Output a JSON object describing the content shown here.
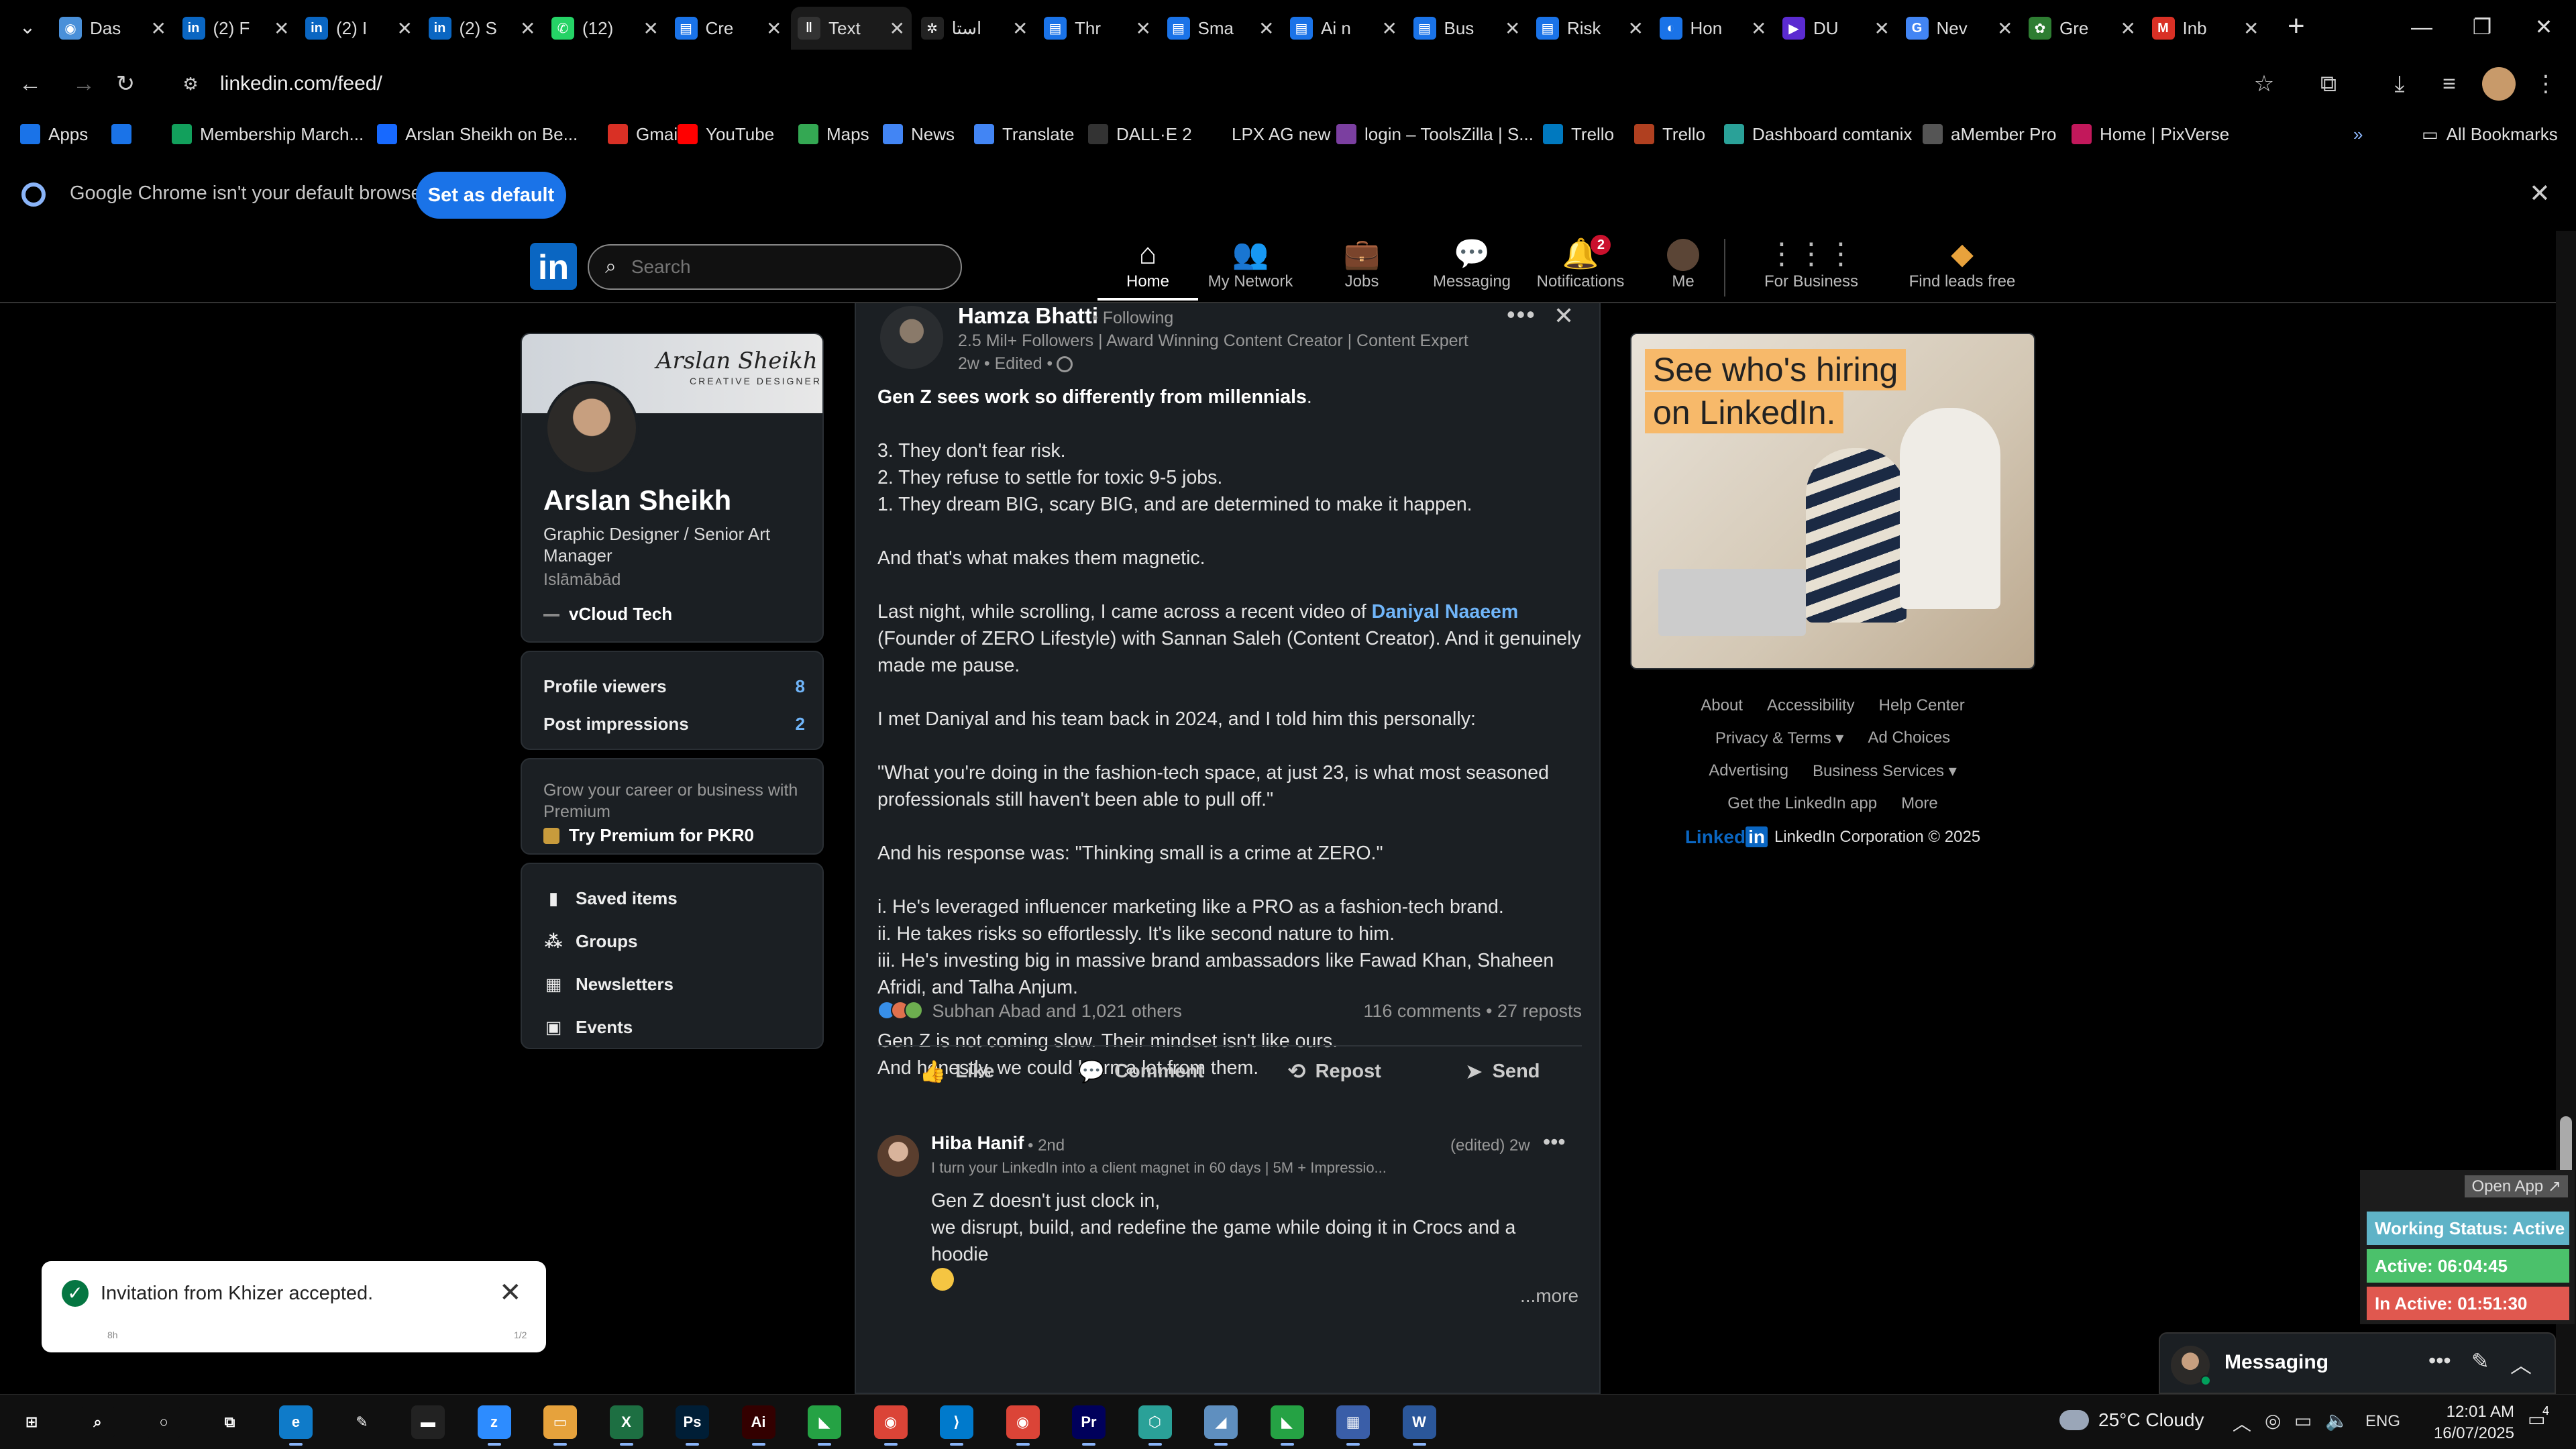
{
  "browser": {
    "tabs": [
      {
        "title": "Das",
        "icon": "chrome-icon",
        "color": "#4a90d9",
        "glyph": "◉"
      },
      {
        "title": "(2) F",
        "icon": "linkedin-icon",
        "color": "#0a66c2",
        "glyph": "in"
      },
      {
        "title": "(2) I",
        "icon": "linkedin-icon",
        "color": "#0a66c2",
        "glyph": "in"
      },
      {
        "title": "(2) S",
        "icon": "linkedin-icon",
        "color": "#0a66c2",
        "glyph": "in"
      },
      {
        "title": "(12)",
        "icon": "whatsapp-icon",
        "color": "#25d366",
        "glyph": "✆"
      },
      {
        "title": "Cre",
        "icon": "docs-icon",
        "color": "#1a73e8",
        "glyph": "▤"
      },
      {
        "title": "Text",
        "icon": "pause-icon",
        "color": "#333333",
        "glyph": "‖"
      },
      {
        "title": "استا",
        "icon": "openai-icon",
        "color": "#222222",
        "glyph": "✲"
      },
      {
        "title": "Thr",
        "icon": "docs-icon",
        "color": "#1a73e8",
        "glyph": "▤"
      },
      {
        "title": "Sma",
        "icon": "docs-icon",
        "color": "#1a73e8",
        "glyph": "▤"
      },
      {
        "title": "Ai n",
        "icon": "docs-icon",
        "color": "#1a73e8",
        "glyph": "▤"
      },
      {
        "title": "Bus",
        "icon": "docs-icon",
        "color": "#1a73e8",
        "glyph": "▤"
      },
      {
        "title": "Risk",
        "icon": "docs-icon",
        "color": "#1a73e8",
        "glyph": "▤"
      },
      {
        "title": "Hon",
        "icon": "globe-icon",
        "color": "#1a73e8",
        "glyph": "◐"
      },
      {
        "title": "DU",
        "icon": "video-icon",
        "color": "#5b2bd1",
        "glyph": "▶"
      },
      {
        "title": "Nev",
        "icon": "google-icon",
        "color": "#4285f4",
        "glyph": "G"
      },
      {
        "title": "Gre",
        "icon": "palm-icon",
        "color": "#2e7d32",
        "glyph": "✿"
      },
      {
        "title": "Inb",
        "icon": "gmail-icon",
        "color": "#d93025",
        "glyph": "M"
      }
    ],
    "new_tab": "+",
    "url": "linkedin.com/feed/",
    "bookmarks": [
      {
        "label": "Apps",
        "icon": "apps-grid-icon",
        "color": "#1a73e8"
      },
      {
        "label": "",
        "icon": "grid-icon",
        "color": "#1a73e8"
      },
      {
        "label": "Membership March...",
        "icon": "bookmark-green-icon",
        "color": "#12a05c"
      },
      {
        "label": "Arslan Sheikh on Be...",
        "icon": "behance-icon",
        "color": "#1769ff"
      },
      {
        "label": "Gmail",
        "icon": "gmail-icon",
        "color": "#d93025"
      },
      {
        "label": "YouTube",
        "icon": "youtube-icon",
        "color": "#ff0000"
      },
      {
        "label": "Maps",
        "icon": "maps-icon",
        "color": "#34a853"
      },
      {
        "label": "News",
        "icon": "news-icon",
        "color": "#4285f4"
      },
      {
        "label": "Translate",
        "icon": "translate-icon",
        "color": "#4285f4"
      },
      {
        "label": "DALL·E 2",
        "icon": "openai-icon",
        "color": "#333333"
      },
      {
        "label": "LPX AG new",
        "icon": "dash-icon",
        "color": "#000000"
      },
      {
        "label": "login – ToolsZilla | S...",
        "icon": "toolszilla-icon",
        "color": "#7b3fa0"
      },
      {
        "label": "Trello",
        "icon": "trello-icon",
        "color": "#0079bf"
      },
      {
        "label": "Trello",
        "icon": "trello-icon",
        "color": "#b04020"
      },
      {
        "label": "Dashboard comtanix",
        "icon": "dashboard-icon",
        "color": "#2aa198"
      },
      {
        "label": "aMember Pro",
        "icon": "amember-icon",
        "color": "#555555"
      },
      {
        "label": "Home | PixVerse",
        "icon": "pixverse-icon",
        "color": "#c2185b"
      }
    ],
    "all_bookmarks": "All Bookmarks",
    "infobar_text": "Google Chrome isn't your default browser",
    "set_default": "Set as default"
  },
  "linkedin": {
    "search_placeholder": "Search",
    "nav": [
      {
        "label": "Home",
        "icon": "home-icon",
        "glyph": "⌂"
      },
      {
        "label": "My Network",
        "icon": "network-icon",
        "glyph": "👥"
      },
      {
        "label": "Jobs",
        "icon": "briefcase-icon",
        "glyph": "💼"
      },
      {
        "label": "Messaging",
        "icon": "messaging-icon",
        "glyph": "💬"
      },
      {
        "label": "Notifications",
        "icon": "bell-icon",
        "glyph": "🔔",
        "badge": "2"
      },
      {
        "label": "Me",
        "icon": "me-avatar-icon",
        "glyph": ""
      },
      {
        "label": "For Business",
        "icon": "grid-icon",
        "glyph": "⋮⋮⋮"
      },
      {
        "label": "Find leads free",
        "icon": "leads-icon",
        "glyph": "◆"
      }
    ],
    "profile": {
      "banner_name": "Arslan Sheikh",
      "banner_sub": "CREATIVE DESIGNER",
      "name": "Arslan Sheikh",
      "headline": "Graphic Designer / Senior Art Manager",
      "location": "Islāmābād",
      "company": "vCloud Tech"
    },
    "stats": [
      {
        "label": "Profile viewers",
        "value": "8"
      },
      {
        "label": "Post impressions",
        "value": "2"
      }
    ],
    "premium": {
      "text": "Grow your career or business with Premium",
      "link": "Try Premium for PKR0"
    },
    "side_links": [
      {
        "label": "Saved items",
        "icon": "bookmark-icon",
        "glyph": "▮"
      },
      {
        "label": "Groups",
        "icon": "groups-icon",
        "glyph": "⁂"
      },
      {
        "label": "Newsletters",
        "icon": "newsletter-icon",
        "glyph": "▦"
      },
      {
        "label": "Events",
        "icon": "calendar-icon",
        "glyph": "▣"
      }
    ],
    "post": {
      "author": "Hamza Bhatti",
      "follow": "• Following",
      "subtitle": "2.5 Mil+ Followers | Award Winning Content Creator | Content Expert",
      "time": "2w • Edited •",
      "headline": "Gen Z sees work so differently from millennials",
      "headline_end": ".",
      "l1": "3. They don't fear risk.",
      "l2": "2. They refuse to settle for toxic 9-5 jobs.",
      "l3": "1. They dream BIG, scary BIG, and are determined to make it happen.",
      "l4": "And that's what makes them magnetic.",
      "l5a": "Last night, while scrolling, I came across a recent video of ",
      "mention": "Daniyal Naaeem",
      "l5b": " (Founder of ZERO Lifestyle) with Sannan Saleh (Content Creator). And it genuinely made me pause.",
      "l6": "I met Daniyal and his team back in 2024, and I told him this personally:",
      "l7": "\"What you're doing in the fashion-tech space, at just 23, is what most seasoned professionals still haven't been able to pull off.\"",
      "l8": "And his response was: \"Thinking small is a crime at ZERO.\"",
      "l9": "i. He's leveraged influencer marketing like a PRO as a fashion-tech brand.",
      "l10": "ii. He takes risks so effortlessly. It's like second nature to him.",
      "l11": "iii. He's investing big in massive brand ambassadors like Fawad Khan, Shaheen Afridi, and Talha Anjum.",
      "l12": "Gen Z is not coming slow. Their mindset isn't like ours.",
      "l13": "And honestly, we could learn a lot from them.",
      "reactions": "Subhan Abad and 1,021 others",
      "comments_reposts": "116 comments • 27 reposts",
      "actions": [
        {
          "label": "Like",
          "icon": "like-icon",
          "glyph": "👍"
        },
        {
          "label": "Comment",
          "icon": "comment-icon",
          "glyph": "💬"
        },
        {
          "label": "Repost",
          "icon": "repost-icon",
          "glyph": "⟲"
        },
        {
          "label": "Send",
          "icon": "send-icon",
          "glyph": "➤"
        }
      ]
    },
    "comment": {
      "author": "Hiba Hanif",
      "degree": "• 2nd",
      "subtitle": "I turn your LinkedIn into a client magnet in 60 days | 5M + Impressio...",
      "time": "(edited) 2w",
      "line1": "Gen Z doesn't just clock in,",
      "line2": "we disrupt, build, and redefine the game while doing it in Crocs and a hoodie",
      "see_more": "...more"
    },
    "ad": {
      "line1": "See who's hiring",
      "line2": "on LinkedIn."
    },
    "footer": {
      "row1": [
        "About",
        "Accessibility",
        "Help Center"
      ],
      "row2": [
        "Privacy & Terms ▾",
        "Ad Choices"
      ],
      "row3": [
        "Advertising",
        "Business Services ▾"
      ],
      "row4": [
        "Get the LinkedIn app",
        "More"
      ],
      "logo": "Linked",
      "logo_in": "in",
      "copyright": "LinkedIn Corporation © 2025"
    },
    "messaging_label": "Messaging"
  },
  "toast": {
    "text": "Invitation from Khizer accepted.",
    "meta_left": "8h",
    "meta_right": "1/2"
  },
  "tracker": {
    "open_app": "Open App ↗",
    "status": "Working Status: Active",
    "active": "Active: 06:04:45",
    "inactive": "In Active: 01:51:30",
    "colors": {
      "status": "#5fb3c7",
      "active": "#4bc16b",
      "inactive": "#e0584f"
    }
  },
  "taskbar": {
    "apps": [
      {
        "icon": "windows-start-icon",
        "color": "#101010",
        "glyph": "⊞"
      },
      {
        "icon": "search-icon",
        "color": "#101010",
        "glyph": "⌕"
      },
      {
        "icon": "cortana-icon",
        "color": "#101010",
        "glyph": "○"
      },
      {
        "icon": "task-view-icon",
        "color": "#101010",
        "glyph": "⧉"
      },
      {
        "icon": "edge-icon",
        "color": "#0f7bc9",
        "glyph": "e"
      },
      {
        "icon": "pen-icon",
        "color": "#101010",
        "glyph": "✎"
      },
      {
        "icon": "terminal-icon",
        "color": "#222222",
        "glyph": "▬"
      },
      {
        "icon": "zoom-icon",
        "color": "#2d8cff",
        "glyph": "z"
      },
      {
        "icon": "file-explorer-icon",
        "color": "#e6a23c",
        "glyph": "▭"
      },
      {
        "icon": "excel-icon",
        "color": "#1d6f42",
        "glyph": "X"
      },
      {
        "icon": "photoshop-icon",
        "color": "#001e36",
        "glyph": "Ps"
      },
      {
        "icon": "illustrator-icon",
        "color": "#330000",
        "glyph": "Ai"
      },
      {
        "icon": "camtasia-icon",
        "color": "#25a244",
        "glyph": "◣"
      },
      {
        "icon": "chrome-icon",
        "color": "#db4437",
        "glyph": "◉"
      },
      {
        "icon": "vscode-icon",
        "color": "#007acc",
        "glyph": "⟩"
      },
      {
        "icon": "chrome-active-icon",
        "color": "#db4437",
        "glyph": "◉"
      },
      {
        "icon": "premiere-icon",
        "color": "#00005b",
        "glyph": "Pr"
      },
      {
        "icon": "app-hex-icon",
        "color": "#2aa198",
        "glyph": "⬡"
      },
      {
        "icon": "app-blade-icon",
        "color": "#5f8fbf",
        "glyph": "◢"
      },
      {
        "icon": "camtasia2-icon",
        "color": "#25a244",
        "glyph": "◣"
      },
      {
        "icon": "calculator-icon",
        "color": "#3a5ea8",
        "glyph": "▦"
      },
      {
        "icon": "word-icon",
        "color": "#2b579a",
        "glyph": "W"
      }
    ],
    "weather": "25°C  Cloudy",
    "lang": "ENG",
    "time": "12:01 AM",
    "date": "16/07/2025",
    "notifications": "4"
  }
}
